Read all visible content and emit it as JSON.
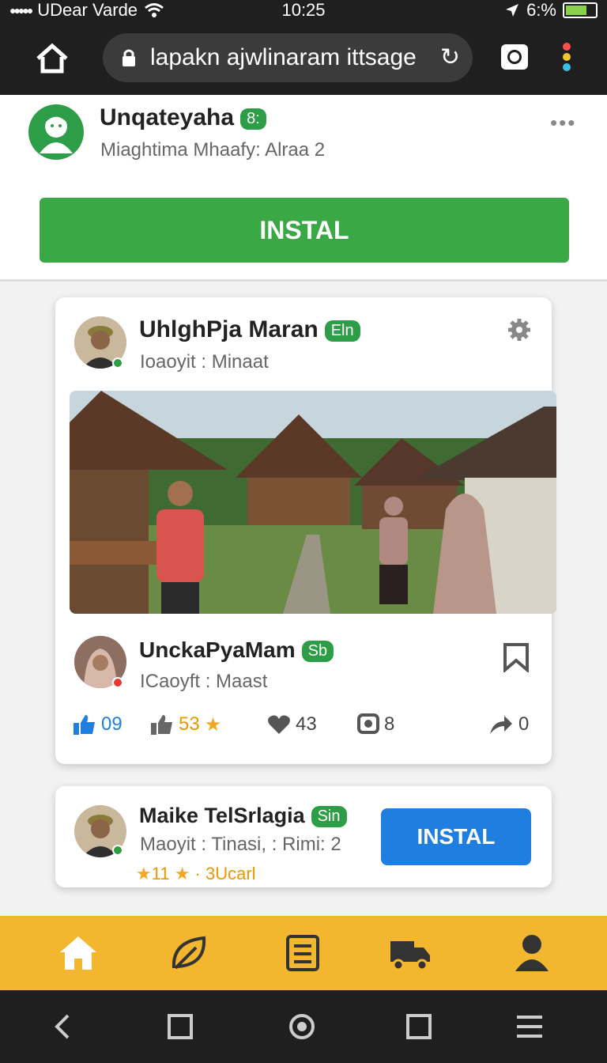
{
  "status_bar": {
    "carrier": "UDear Varde",
    "time": "10:25",
    "battery": "6:%"
  },
  "browser": {
    "url": "lapakn ajwlinaram ittsage"
  },
  "top_app": {
    "name": "Unqateyaha",
    "badge": "8:",
    "meta": "Miaghtima Mhaafy: Alraa 2",
    "install_label": "INSTAL"
  },
  "post": {
    "author": "UhlghPja Maran",
    "badge": "Eln",
    "meta": "Ioaoyit : Minaat",
    "commenter": "UnckaPyaMam",
    "commenter_badge": "Sb",
    "commenter_meta": "ICaoyft : Maast",
    "actions": {
      "likes": "09",
      "rating": "53",
      "hearts": "43",
      "comments": "8",
      "shares": "0"
    }
  },
  "second_app": {
    "name": "Maike TelSrlagia",
    "badge": "Sin",
    "meta": "Maoyit : Tinasi, : Rimi: 2",
    "rating": "11",
    "rating_text": "3Ucarl",
    "install_label": "INSTAL"
  },
  "bottom_nav": [
    "home-icon",
    "leaf-icon",
    "list-icon",
    "truck-icon",
    "profile-icon"
  ],
  "colors": {
    "green": "#3aa844",
    "blue": "#1f7fe0",
    "nav_bg": "#f2b62f"
  }
}
